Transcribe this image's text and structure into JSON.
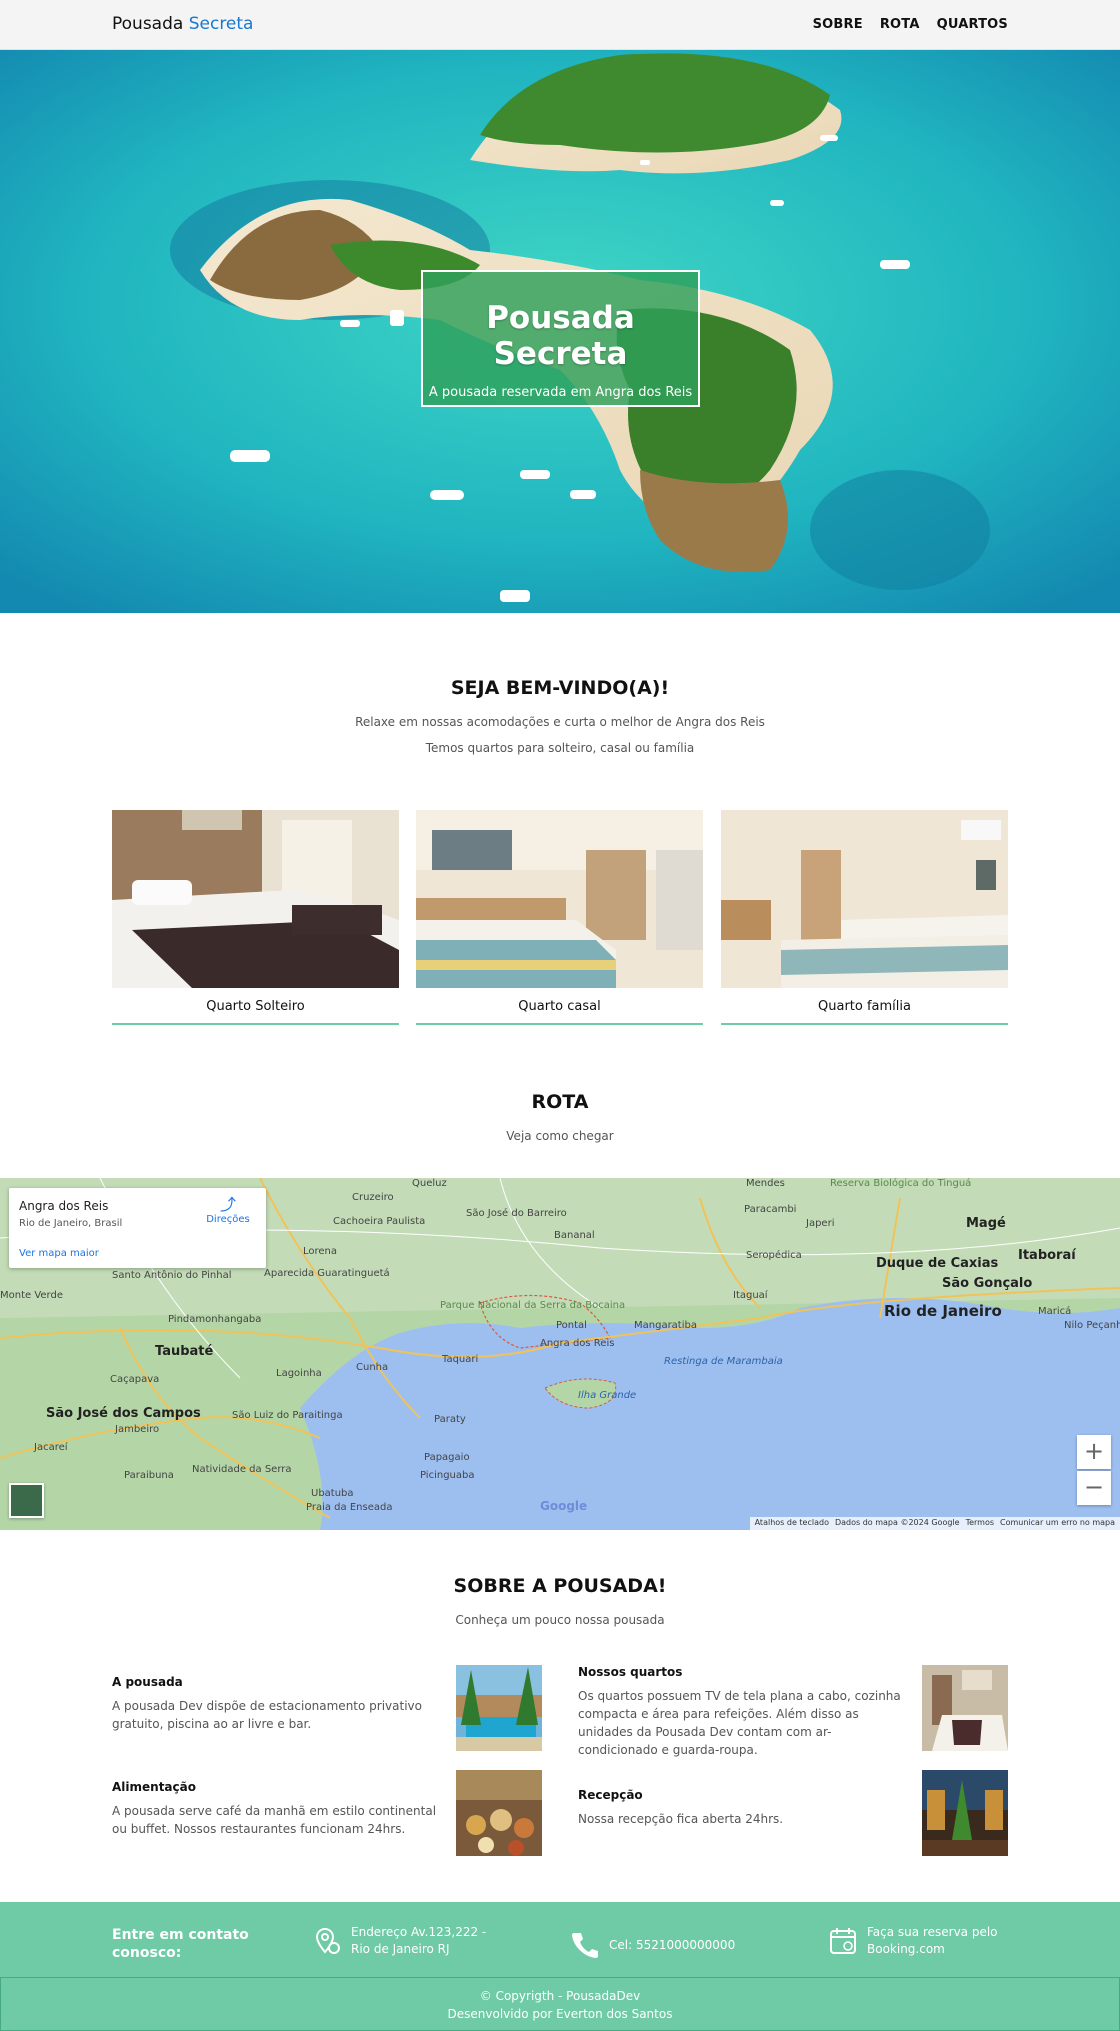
{
  "header": {
    "brand_main": "Pousada",
    "brand_accent": "Secreta",
    "nav": [
      "SOBRE",
      "ROTA",
      "QUARTOS"
    ]
  },
  "hero": {
    "title": "Pousada Secreta",
    "subtitle": "A pousada reservada em Angra dos Reis"
  },
  "welcome": {
    "title": "SEJA BEM-VINDO(A)!",
    "line1": "Relaxe em nossas acomodações e curta o melhor de Angra dos Reis",
    "line2": "Temos quartos para solteiro, casal ou família"
  },
  "rooms": [
    {
      "label": "Quarto Solteiro"
    },
    {
      "label": "Quarto casal"
    },
    {
      "label": "Quarto família"
    }
  ],
  "route": {
    "title": "ROTA",
    "subtitle": "Veja como chegar"
  },
  "map": {
    "place_title": "Angra dos Reis",
    "place_sub": "Rio de Janeiro, Brasil",
    "larger_map": "Ver mapa maior",
    "directions": "Direções",
    "zoom_in": "+",
    "zoom_out": "−",
    "google": "Google",
    "attribution": [
      "Atalhos de teclado",
      "Dados do mapa ©2024 Google",
      "Termos",
      "Comunicar um erro no mapa"
    ],
    "labels": {
      "queluz": "Queluz",
      "cruzeiro": "Cruzeiro",
      "cachoeira": "Cachoeira Paulista",
      "lorena": "Lorena",
      "guaratingueta": "Aparecida Guaratinguetá",
      "santo_antonio": "Santo Antônio do Pinhal",
      "pindamonhangaba": "Pindamonhangaba",
      "taubate": "Taubaté",
      "cacapava": "Caçapava",
      "sao_jose": "São José dos Campos",
      "jacarei": "Jacareí",
      "jambeiro": "Jambeiro",
      "paraibuna": "Paraibuna",
      "natividade": "Natividade da Serra",
      "ubatuba": "Ubatuba",
      "praia_enseada": "Praia da Enseada",
      "lagoinha": "Lagoinha",
      "cunha": "Cunha",
      "sao_luiz": "São Luiz do Paraitinga",
      "paraty": "Paraty",
      "picinguaba": "Picinguaba",
      "papagaio": "Papagaio",
      "parque": "Parque Nacional da Serra da Bocaina",
      "taquari": "Taquari",
      "angra": "Angra dos Reis",
      "pontal": "Pontal",
      "mangaratiba": "Mangaratiba",
      "ilha_grande": "Ilha Grande",
      "restinga": "Restinga de Marambaia",
      "itaguai": "Itaguaí",
      "seropedica": "Seropédica",
      "bananal": "Bananal",
      "sao_jose_barreiro": "São José do Barreiro",
      "paracambi": "Paracambi",
      "japeri": "Japeri",
      "duque": "Duque de Caxias",
      "sao_goncalo": "São Gonçalo",
      "rio": "Rio de Janeiro",
      "mage": "Magé",
      "itaborai": "Itaboraí",
      "marica": "Maricá",
      "nilo": "Nilo Peçanha",
      "monte_verde": "Monte Verde",
      "reserva": "Reserva Biológica do Tinguá",
      "mendes": "Mendes"
    }
  },
  "about": {
    "title": "SOBRE A POUSADA!",
    "subtitle": "Conheça um pouco nossa pousada",
    "features": [
      {
        "title": "A pousada",
        "text": "A pousada Dev dispõe de estacionamento privativo gratuito, piscina ao ar livre e bar."
      },
      {
        "title": "Nossos quartos",
        "text": "Os quartos possuem TV de tela plana a cabo, cozinha compacta e área para refeições. Além disso as unidades da Pousada Dev contam com ar-condicionado e guarda-roupa."
      },
      {
        "title": "Alimentação",
        "text": "A pousada serve café da manhã em estilo continental ou buffet. Nossos restaurantes funcionam 24hrs."
      },
      {
        "title": "Recepção",
        "text": "Nossa recepção fica aberta 24hrs."
      }
    ]
  },
  "footer": {
    "contact_title": "Entre em contato conosco:",
    "address_line1": "Endereço Av.123,222 -",
    "address_line2": "Rio de Janeiro RJ",
    "phone": "Cel: 5521000000000",
    "booking_line1": "Faça sua reserva pelo",
    "booking_line2": "Booking.com",
    "copyright": "© Copyrigth - PousadaDev",
    "developer": "Desenvolvido por Everton dos Santos"
  },
  "colors": {
    "accent_green": "#6fcaa6",
    "brand_blue": "#1877d2"
  }
}
